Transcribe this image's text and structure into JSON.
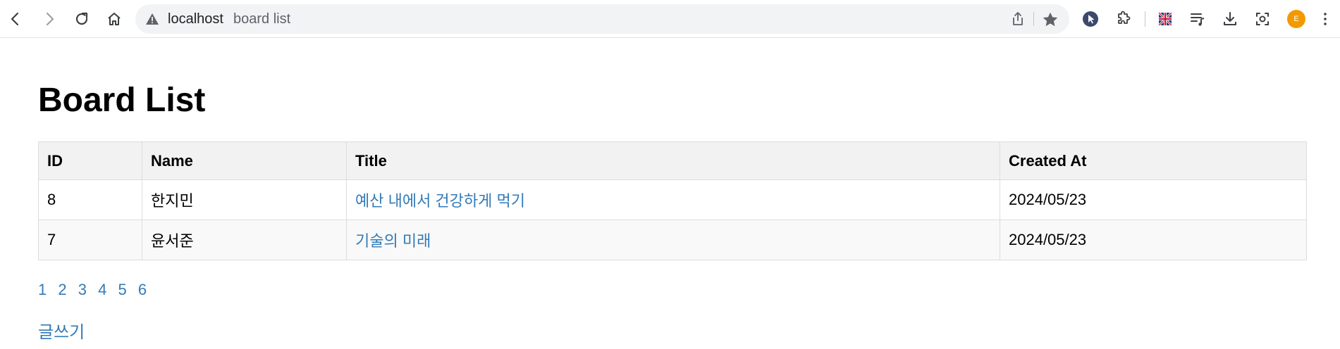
{
  "browser": {
    "host": "localhost",
    "path": "board list",
    "avatar_letter": "E"
  },
  "page": {
    "heading": "Board List",
    "columns": [
      "ID",
      "Name",
      "Title",
      "Created At"
    ],
    "rows": [
      {
        "id": "8",
        "name": "한지민",
        "title": "예산 내에서 건강하게 먹기",
        "created": "2024/05/23"
      },
      {
        "id": "7",
        "name": "윤서준",
        "title": "기술의 미래",
        "created": "2024/05/23"
      }
    ],
    "pages": [
      "1",
      "2",
      "3",
      "4",
      "5",
      "6"
    ],
    "write_link": "글쓰기",
    "link_color": "#337ab7"
  }
}
